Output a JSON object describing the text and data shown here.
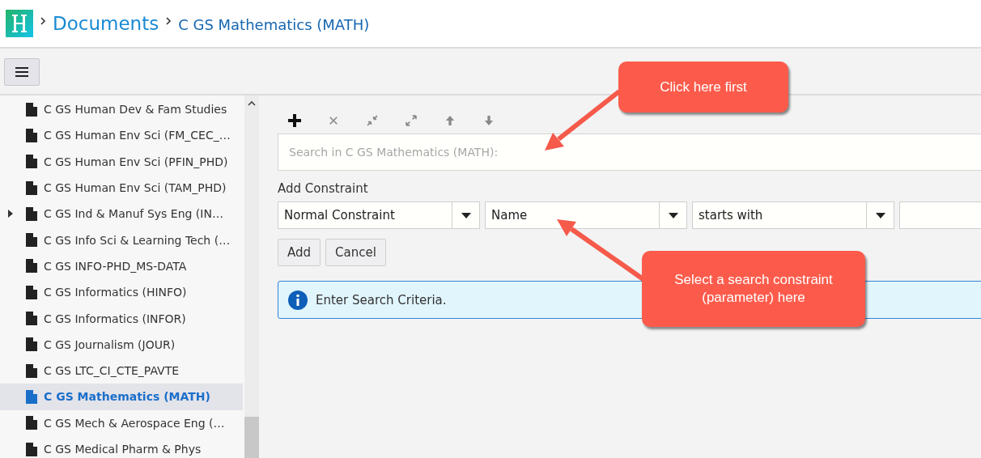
{
  "breadcrumb": {
    "root": "Documents",
    "current": "C GS Mathematics (MATH)"
  },
  "sidebar": {
    "items": [
      {
        "label": "C GS Human Dev & Fam Studies",
        "expandable": false,
        "selected": false
      },
      {
        "label": "C GS Human Env Sci (FM_CEC_…",
        "expandable": false,
        "selected": false
      },
      {
        "label": "C GS Human Env Sci (PFIN_PHD)",
        "expandable": false,
        "selected": false
      },
      {
        "label": "C GS Human Env Sci (TAM_PHD)",
        "expandable": false,
        "selected": false
      },
      {
        "label": "C GS Ind & Manuf Sys Eng (IN…",
        "expandable": true,
        "selected": false
      },
      {
        "label": "C GS Info Sci & Learning Tech (…",
        "expandable": false,
        "selected": false
      },
      {
        "label": "C GS INFO-PHD_MS-DATA",
        "expandable": false,
        "selected": false
      },
      {
        "label": "C GS Informatics (HINFO)",
        "expandable": false,
        "selected": false
      },
      {
        "label": "C GS Informatics (INFOR)",
        "expandable": false,
        "selected": false
      },
      {
        "label": "C GS Journalism (JOUR)",
        "expandable": false,
        "selected": false
      },
      {
        "label": "C GS LTC_CI_CTE_PAVTE",
        "expandable": false,
        "selected": false
      },
      {
        "label": "C GS Mathematics (MATH)",
        "expandable": false,
        "selected": true
      },
      {
        "label": "C GS Mech & Aerospace Eng (…",
        "expandable": false,
        "selected": false
      },
      {
        "label": "C GS Medical Pharm & Phys",
        "expandable": false,
        "selected": false
      }
    ]
  },
  "toolbar": [
    {
      "kind": "add",
      "disabled": false
    },
    {
      "kind": "remove",
      "disabled": true
    },
    {
      "kind": "collapse",
      "disabled": true
    },
    {
      "kind": "expand",
      "disabled": true
    },
    {
      "kind": "up",
      "disabled": true
    },
    {
      "kind": "down",
      "disabled": true
    }
  ],
  "search": {
    "placeholder": "Search in C GS Mathematics (MATH):"
  },
  "constraint": {
    "heading": "Add Constraint",
    "selects": [
      "Normal Constraint",
      "Name",
      "starts with"
    ],
    "buttons": [
      "Add",
      "Cancel"
    ]
  },
  "message": "Enter Search Criteria.",
  "callouts": [
    "Click here first",
    "Select a search constraint (parameter) here"
  ]
}
